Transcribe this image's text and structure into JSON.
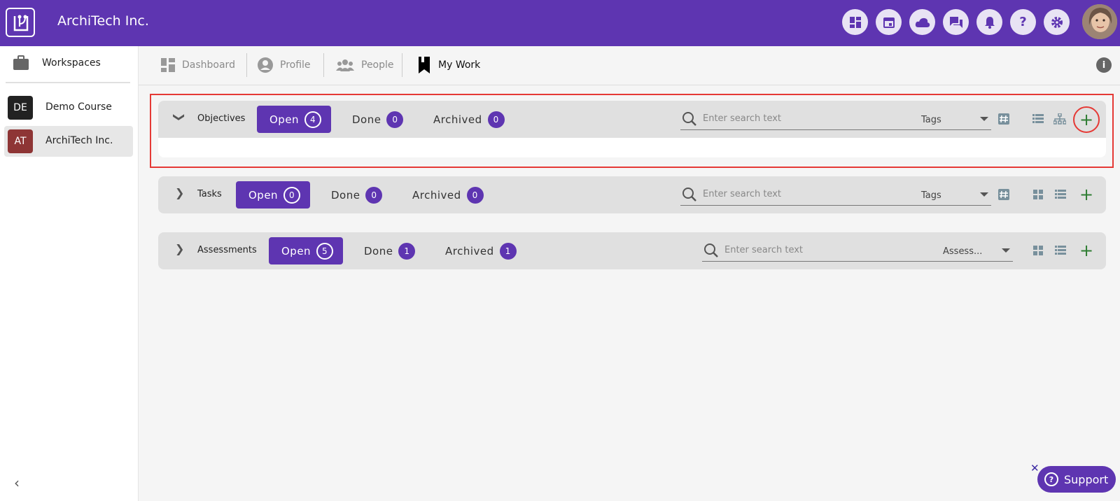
{
  "app": {
    "title": "ArchiTech Inc.",
    "logo_icon": "book-logo-icon"
  },
  "top_icons": [
    "dashboard-icon",
    "calendar-icon",
    "cloud-icon",
    "chat-icon",
    "bell-icon",
    "help-icon",
    "gear-icon"
  ],
  "sidebar": {
    "title": "Workspaces",
    "items": [
      {
        "badge": "DE",
        "label": "Demo Course",
        "badge_color": "#222222",
        "active": false
      },
      {
        "badge": "AT",
        "label": "ArchiTech Inc.",
        "badge_color": "#8e3535",
        "active": true
      }
    ],
    "collapse": "‹"
  },
  "nav": {
    "items": [
      {
        "label": "Dashboard",
        "icon": "dashboard-icon",
        "active": false
      },
      {
        "label": "Profile",
        "icon": "profile-icon",
        "active": false
      },
      {
        "label": "People",
        "icon": "people-icon",
        "active": false
      },
      {
        "label": "My Work",
        "icon": "bookmark-icon",
        "active": true
      }
    ],
    "info": "i"
  },
  "sections": [
    {
      "title": "Objectives",
      "expanded": true,
      "open_label": "Open",
      "open_count": "4",
      "done_label": "Done",
      "done_count": "0",
      "archived_label": "Archived",
      "archived_count": "0",
      "search_placeholder": "Enter search text",
      "filter_label": "Tags",
      "icons": [
        "hashtag-icon",
        "list-icon",
        "hierarchy-icon",
        "add-icon"
      ]
    },
    {
      "title": "Tasks",
      "expanded": false,
      "open_label": "Open",
      "open_count": "0",
      "done_label": "Done",
      "done_count": "0",
      "archived_label": "Archived",
      "archived_count": "0",
      "search_placeholder": "Enter search text",
      "filter_label": "Tags",
      "icons": [
        "hashtag-icon",
        "grid-icon",
        "list-icon",
        "add-icon"
      ]
    },
    {
      "title": "Assessments",
      "expanded": false,
      "open_label": "Open",
      "open_count": "5",
      "done_label": "Done",
      "done_count": "1",
      "archived_label": "Archived",
      "archived_count": "1",
      "search_placeholder": "Enter search text",
      "filter_label": "Assess...",
      "icons": [
        "grid-icon",
        "list-icon",
        "add-icon"
      ]
    }
  ],
  "support": {
    "label": "Support",
    "close": "✕"
  },
  "colors": {
    "brand": "#5e35b1",
    "add": "#2e7d32",
    "highlight": "#e53935"
  }
}
